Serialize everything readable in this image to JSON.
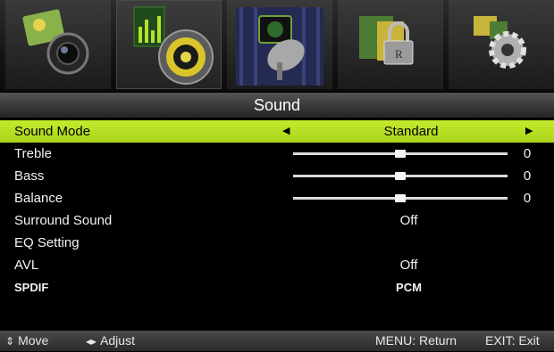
{
  "header": {
    "title": "Sound"
  },
  "tabs": [
    {
      "icon": "picture-icon"
    },
    {
      "icon": "sound-icon",
      "active": true
    },
    {
      "icon": "channel-icon"
    },
    {
      "icon": "lock-icon"
    },
    {
      "icon": "setup-icon"
    }
  ],
  "menu": {
    "sound_mode": {
      "label": "Sound Mode",
      "value": "Standard",
      "left_arrow": "◀",
      "right_arrow": "▶"
    },
    "treble": {
      "label": "Treble",
      "value": "0",
      "level": 0.5
    },
    "bass": {
      "label": "Bass",
      "value": "0",
      "level": 0.5
    },
    "balance": {
      "label": "Balance",
      "value": "0",
      "level": 0.5
    },
    "surround": {
      "label": "Surround Sound",
      "value": "Off"
    },
    "eq": {
      "label": "EQ Setting"
    },
    "avl": {
      "label": "AVL",
      "value": "Off"
    },
    "spdif": {
      "label": "SPDIF",
      "value": "PCM"
    }
  },
  "footer": {
    "move_icon": "⇕",
    "move_label": "Move",
    "adjust_icon": "◂▸",
    "adjust_label": "Adjust",
    "menu_label": "MENU: Return",
    "exit_label": "EXIT: Exit"
  },
  "colors": {
    "highlight": "#b9e022",
    "background": "#000000"
  }
}
